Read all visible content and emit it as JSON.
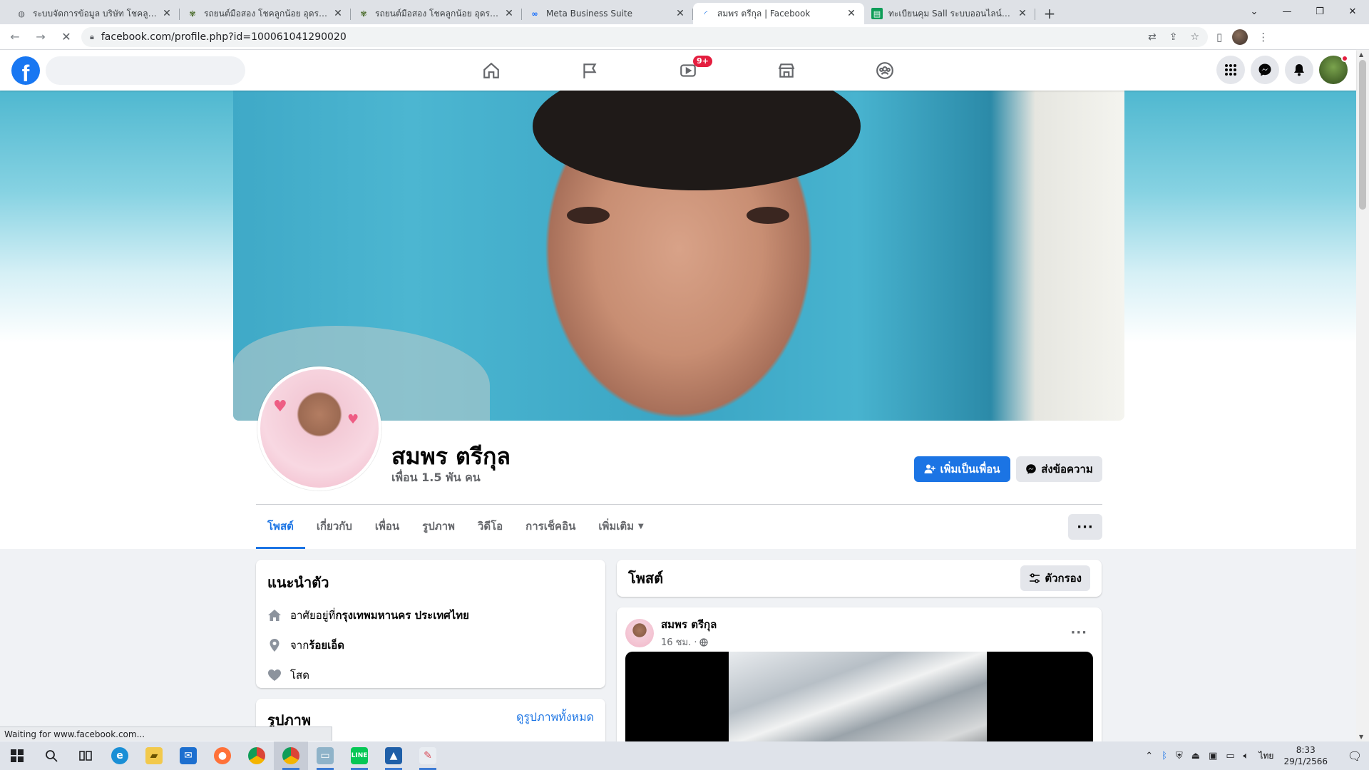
{
  "browser": {
    "tabs": [
      {
        "title": "ระบบจัดการข้อมูล บริษัท โชคลูกน้อย อุ",
        "icon": "globe-icon",
        "active": false
      },
      {
        "title": "รถยนต์มือสอง โชคลูกน้อย อุดรธานี",
        "icon": "site-logo-icon",
        "active": false
      },
      {
        "title": "รถยนต์มือสอง โชคลูกน้อย อุดรธานี",
        "icon": "site-logo-icon",
        "active": false
      },
      {
        "title": "Meta Business Suite",
        "icon": "meta-icon",
        "active": false
      },
      {
        "title": "สมพร ตรีกุล | Facebook",
        "icon": "loading-icon",
        "active": true
      },
      {
        "title": "ทะเบียนคุม Sall ระบบออนไลน์.xlsx - G",
        "icon": "sheets-icon",
        "active": false
      }
    ],
    "url": "facebook.com/profile.php?id=100061041290020",
    "status_text": "Waiting for www.facebook.com..."
  },
  "facebook": {
    "nav_badge": "9+",
    "profile": {
      "name": "สมพร ตรีกุล",
      "friends": "เพื่อน 1.5 พัน คน",
      "add_friend_label": "เพิ่มเป็นเพื่อน",
      "message_label": "ส่งข้อความ"
    },
    "tabs": [
      "โพสต์",
      "เกี่ยวกับ",
      "เพื่อน",
      "รูปภาพ",
      "วิดีโอ",
      "การเช็คอิน",
      "เพิ่มเติม"
    ],
    "intro": {
      "title": "แนะนำตัว",
      "lives_prefix": "อาศัยอยู่ที่ ",
      "lives_value": "กรุงเทพมหานคร ประเทศไทย",
      "from_prefix": "จาก ",
      "from_value": "ร้อยเอ็ด",
      "relationship": "โสด"
    },
    "photos": {
      "title": "รูปภาพ",
      "see_all": "ดูรูปภาพทั้งหมด"
    },
    "posts": {
      "title": "โพสต์",
      "filter_label": "ตัวกรอง",
      "first_post": {
        "author": "สมพร ตรีกุล",
        "time": "16 ชม. ·"
      }
    }
  },
  "taskbar": {
    "lang": "ไทย",
    "time": "8:33",
    "date": "29/1/2566"
  }
}
